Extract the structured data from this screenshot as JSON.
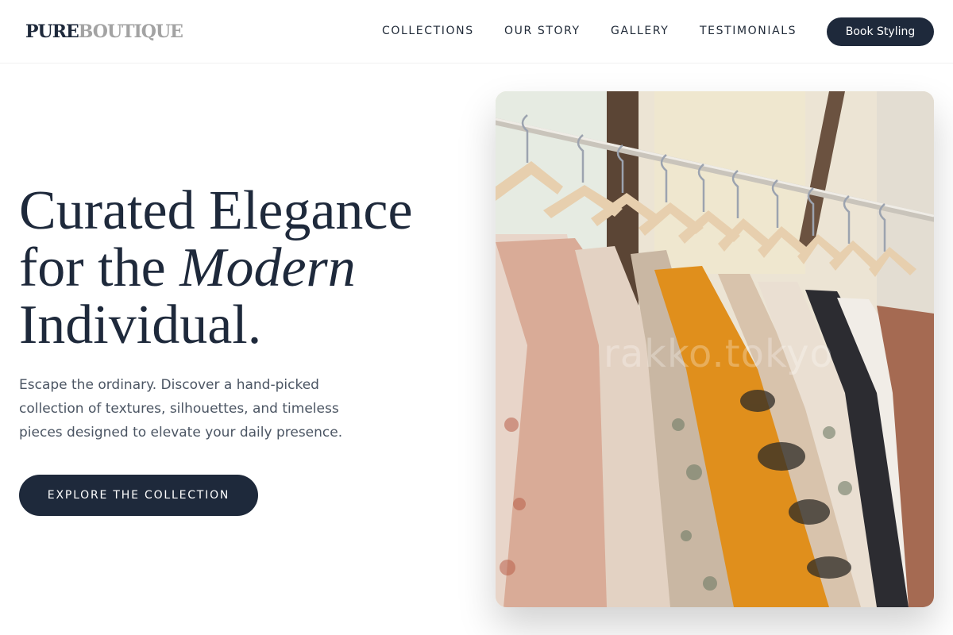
{
  "brand": {
    "part1": "PURE",
    "part2": "BOUTIQUE"
  },
  "nav": {
    "items": [
      "COLLECTIONS",
      "OUR STORY",
      "GALLERY",
      "TESTIMONIALS"
    ],
    "cta_label": "Book Styling"
  },
  "hero": {
    "title_line1": "Curated Elegance",
    "title_line2_prefix": "for the ",
    "title_line2_emphasis": "Modern",
    "title_line3": "Individual.",
    "description": "Escape the ordinary. Discover a hand-picked collection of textures, silhouettes, and timeless pieces designed to elevate your daily presence.",
    "cta_label": "EXPLORE THE COLLECTION"
  },
  "image": {
    "subject": "clothing-rack-photo",
    "watermark": "rakko.tokyo"
  },
  "colors": {
    "primary": "#1e293b",
    "muted": "#a3a3a3",
    "body_text": "#4b5563"
  }
}
